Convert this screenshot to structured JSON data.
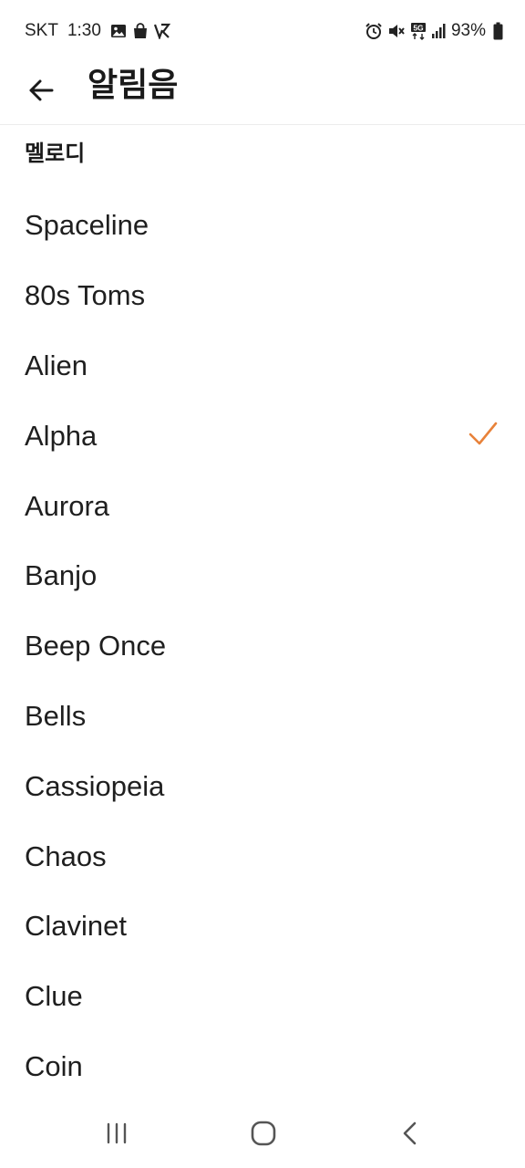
{
  "status_bar": {
    "carrier": "SKT",
    "time": "1:30",
    "battery_percent": "93%",
    "left_icons": [
      "image-icon",
      "shopping-bag-icon",
      "app-notification-icon"
    ],
    "right_icons": [
      "alarm-icon",
      "mute-icon",
      "5g-icon",
      "signal-icon",
      "battery-icon"
    ]
  },
  "header": {
    "title": "알림음",
    "back_icon": "arrow-left-icon"
  },
  "section": {
    "title": "멜로디"
  },
  "accent_color": "#e8823a",
  "sounds": [
    {
      "label": "Spaceline",
      "selected": false
    },
    {
      "label": "80s Toms",
      "selected": false
    },
    {
      "label": "Alien",
      "selected": false
    },
    {
      "label": "Alpha",
      "selected": true
    },
    {
      "label": "Aurora",
      "selected": false
    },
    {
      "label": "Banjo",
      "selected": false
    },
    {
      "label": "Beep Once",
      "selected": false
    },
    {
      "label": "Bells",
      "selected": false
    },
    {
      "label": "Cassiopeia",
      "selected": false
    },
    {
      "label": "Chaos",
      "selected": false
    },
    {
      "label": "Clavinet",
      "selected": false
    },
    {
      "label": "Clue",
      "selected": false
    },
    {
      "label": "Coin",
      "selected": false
    }
  ],
  "nav_bar": {
    "icons": [
      "recent-apps-icon",
      "home-icon",
      "back-icon"
    ]
  }
}
